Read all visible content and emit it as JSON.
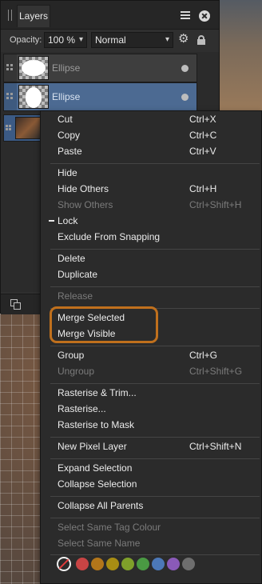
{
  "panel": {
    "tab_label": "Layers",
    "opacity_label": "Opacity:",
    "opacity_value": "100 %",
    "blend_mode": "Normal",
    "layers": [
      {
        "name": "Ellipse",
        "selected": false
      },
      {
        "name": "Ellipse",
        "selected": true
      },
      {
        "name": "",
        "selected": true
      }
    ]
  },
  "menu": {
    "items": [
      {
        "label": "Cut",
        "shortcut": "Ctrl+X",
        "disabled": false
      },
      {
        "label": "Copy",
        "shortcut": "Ctrl+C",
        "disabled": false
      },
      {
        "label": "Paste",
        "shortcut": "Ctrl+V",
        "disabled": false
      },
      {
        "label": "Hide",
        "shortcut": "",
        "disabled": false
      },
      {
        "label": "Hide Others",
        "shortcut": "Ctrl+H",
        "disabled": false
      },
      {
        "label": "Show Others",
        "shortcut": "Ctrl+Shift+H",
        "disabled": true
      },
      {
        "label": "Lock",
        "shortcut": "",
        "disabled": false,
        "checked": true
      },
      {
        "label": "Exclude From Snapping",
        "shortcut": "",
        "disabled": false
      },
      {
        "label": "Delete",
        "shortcut": "",
        "disabled": false
      },
      {
        "label": "Duplicate",
        "shortcut": "",
        "disabled": false
      },
      {
        "label": "Release",
        "shortcut": "",
        "disabled": true
      },
      {
        "label": "Merge Selected",
        "shortcut": "",
        "disabled": false
      },
      {
        "label": "Merge Visible",
        "shortcut": "",
        "disabled": false
      },
      {
        "label": "Group",
        "shortcut": "Ctrl+G",
        "disabled": false
      },
      {
        "label": "Ungroup",
        "shortcut": "Ctrl+Shift+G",
        "disabled": true
      },
      {
        "label": "Rasterise & Trim...",
        "shortcut": "",
        "disabled": false
      },
      {
        "label": "Rasterise...",
        "shortcut": "",
        "disabled": false
      },
      {
        "label": "Rasterise to Mask",
        "shortcut": "",
        "disabled": false
      },
      {
        "label": "New Pixel Layer",
        "shortcut": "Ctrl+Shift+N",
        "disabled": false
      },
      {
        "label": "Expand Selection",
        "shortcut": "",
        "disabled": false
      },
      {
        "label": "Collapse Selection",
        "shortcut": "",
        "disabled": false
      },
      {
        "label": "Collapse All Parents",
        "shortcut": "",
        "disabled": false
      },
      {
        "label": "Select Same Tag Colour",
        "shortcut": "",
        "disabled": true
      },
      {
        "label": "Select Same Name",
        "shortcut": "",
        "disabled": true
      }
    ],
    "tag_colors": [
      "#c84444",
      "#b3761a",
      "#a88d13",
      "#7fa02a",
      "#4a9a43",
      "#4c78b8",
      "#8a5ab8",
      "#6e6e6e"
    ]
  },
  "colors": {
    "highlight_outline": "#c0701d",
    "selected_row": "#4c6a92"
  }
}
